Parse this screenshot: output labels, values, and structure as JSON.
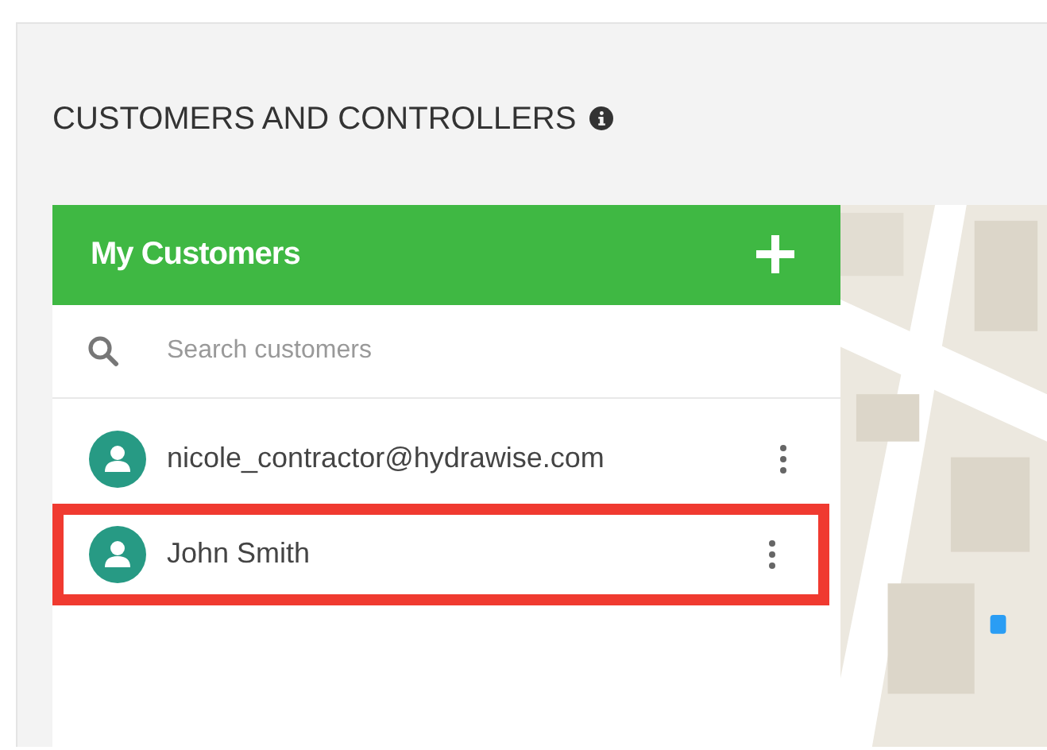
{
  "section": {
    "title": "CUSTOMERS AND CONTROLLERS"
  },
  "customers_panel": {
    "title": "My Customers",
    "search": {
      "placeholder": "Search customers"
    },
    "rows": [
      {
        "name": "nicole_contractor@hydrawise.com",
        "highlighted": false
      },
      {
        "name": "John Smith",
        "highlighted": true
      }
    ]
  }
}
